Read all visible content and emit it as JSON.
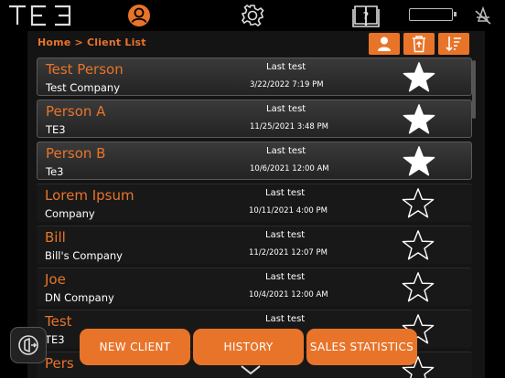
{
  "colors": {
    "accent": "#e8742a",
    "background": "#000000",
    "panel": "#141414"
  },
  "header": {
    "logo_text": "TE3",
    "icons": [
      "logo",
      "user-circle-icon",
      "gear-icon",
      "help-book-icon",
      "battery-icon",
      "signal-icon"
    ]
  },
  "breadcrumb": "Home > Client List",
  "toolbar": {
    "icons": [
      "person-icon",
      "trash-icon",
      "sort-icon"
    ]
  },
  "clients": [
    {
      "name": "Test Person",
      "company": "Test Company",
      "last_test_label": "Last test",
      "last_test_date": "3/22/2022  7:19 PM",
      "favorite": true
    },
    {
      "name": "Person A",
      "company": "TE3",
      "last_test_label": "Last test",
      "last_test_date": "11/25/2021  3:48 PM",
      "favorite": true
    },
    {
      "name": "Person B",
      "company": "Te3",
      "last_test_label": "Last test",
      "last_test_date": "10/6/2021  12:00 AM",
      "favorite": true
    },
    {
      "name": "Lorem Ipsum",
      "company": "Company",
      "last_test_label": "Last test",
      "last_test_date": "10/11/2021  4:00 PM",
      "favorite": false
    },
    {
      "name": "Bill",
      "company": "Bill's Company",
      "last_test_label": "Last test",
      "last_test_date": "11/2/2021  12:07 PM",
      "favorite": false
    },
    {
      "name": "Joe",
      "company": "DN Company",
      "last_test_label": "Last test",
      "last_test_date": "10/4/2021  12:00 AM",
      "favorite": false
    },
    {
      "name": "Test",
      "company": "TE3",
      "last_test_label": "Last test",
      "last_test_date": "",
      "favorite": false
    },
    {
      "name": "Pers",
      "company": "",
      "last_test_label": "",
      "last_test_date": "",
      "favorite": false
    }
  ],
  "actions": {
    "new_client": "NEW CLIENT",
    "history": "HISTORY",
    "sales_statistics": "SALES STATISTICS"
  }
}
